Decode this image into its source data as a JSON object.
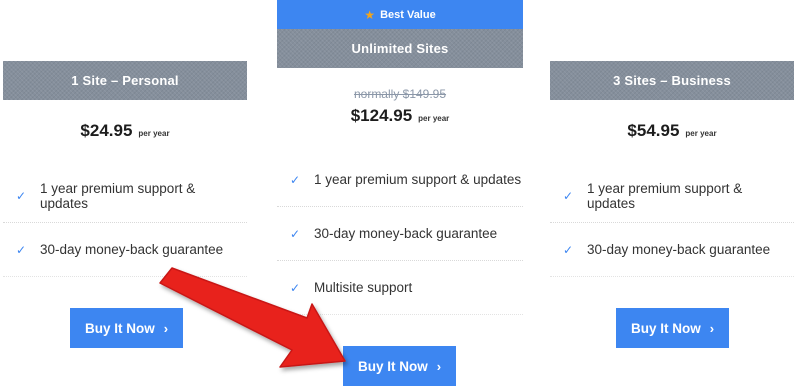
{
  "plans": {
    "personal": {
      "title": "1 Site – Personal",
      "price": "$24.95",
      "period": "per year",
      "features": [
        "1 year premium support & updates",
        "30-day money-back guarantee"
      ],
      "button_label": "Buy It Now"
    },
    "unlimited": {
      "badge": "Best Value",
      "title": "Unlimited Sites",
      "old_price": "normally $149.95",
      "price": "$124.95",
      "period": "per year",
      "features": [
        "1 year premium support & updates",
        "30-day money-back guarantee",
        "Multisite support"
      ],
      "button_label": "Buy It Now"
    },
    "business": {
      "title": "3 Sites – Business",
      "price": "$54.95",
      "period": "per year",
      "features": [
        "1 year premium support & updates",
        "30-day money-back guarantee"
      ],
      "button_label": "Buy It Now"
    }
  },
  "icons": {
    "badge_icon": "star-icon",
    "feature_icon": "check-icon",
    "button_icon": "chevron-right-icon",
    "annotation": "red-arrow"
  },
  "colors": {
    "accent": "#3d86f1",
    "header_gray": "#858f9c",
    "star": "#f3a51b",
    "arrow_red": "#e8231f"
  }
}
